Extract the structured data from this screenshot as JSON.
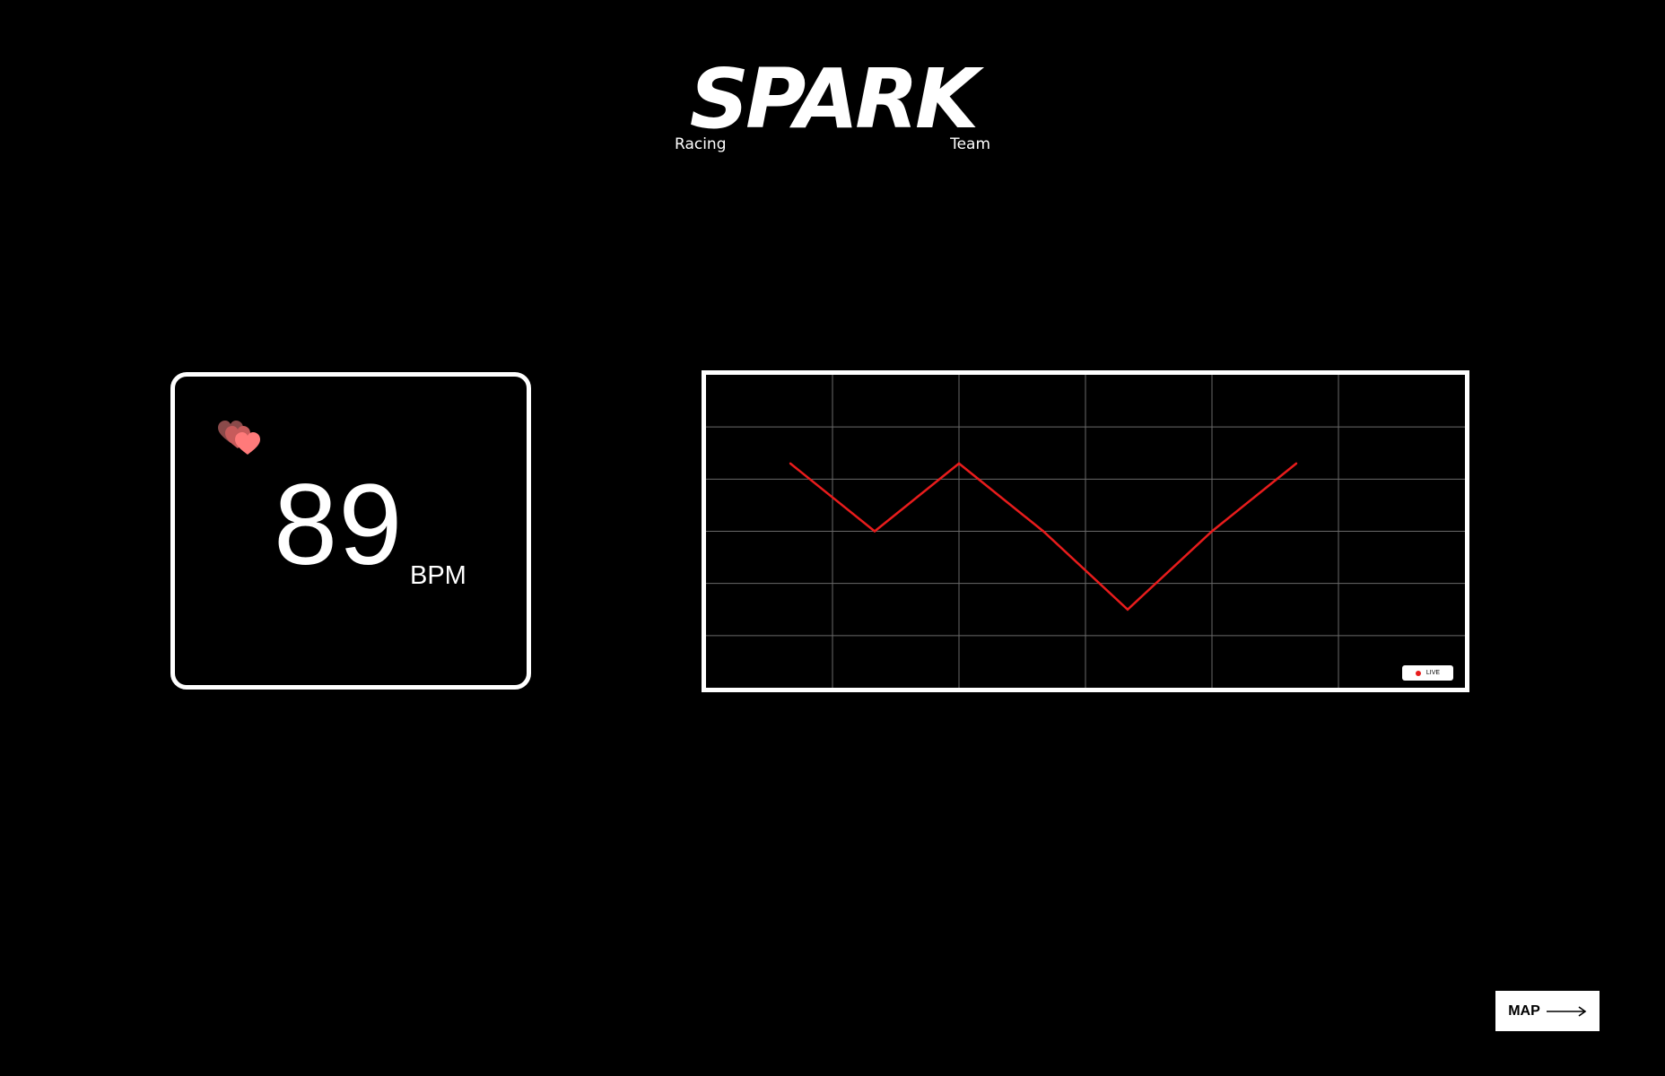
{
  "logo": {
    "word": "SPARK",
    "subtitle": "Racing Team"
  },
  "heart_rate": {
    "value": "89",
    "unit": "BPM",
    "icon": "heart-icon",
    "icon_colors": [
      "#ff7a7a",
      "#c75b5b",
      "#8a4a4a"
    ]
  },
  "chart": {
    "badge_label": "LIVE",
    "badge_dot_color": "#e81c1c",
    "line_color": "#e81c1c",
    "grid_color": "#6a6a6a"
  },
  "chart_data": {
    "type": "line",
    "grid": true,
    "xlabel": "",
    "ylabel": "",
    "x": [
      1,
      2,
      3,
      4,
      5,
      6,
      7
    ],
    "xlim": [
      0,
      9
    ],
    "ylim": [
      0,
      6
    ],
    "series": [
      {
        "values": [
          4.3,
          3.0,
          4.3,
          3.0,
          1.5,
          3.0,
          4.3
        ]
      }
    ]
  },
  "nav": {
    "map_label": "MAP",
    "arrow_icon": "arrow-right-icon"
  }
}
